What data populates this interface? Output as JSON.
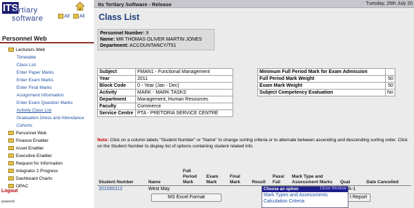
{
  "app": {
    "title": "Its Tertiary Software - Release",
    "date": "Tuesday, 26th July 20"
  },
  "logo": {
    "its": "ITS",
    "line1": "tertiary",
    "line2": "software"
  },
  "sidebar": {
    "expand_label": "All",
    "collapse_label": "All",
    "header": "Personnel Web",
    "tree": [
      {
        "label": "Lecturers Web",
        "type": "folder"
      },
      {
        "label": "Timetable",
        "type": "child"
      },
      {
        "label": "Class List",
        "type": "child"
      },
      {
        "label": "Enter Paper Marks",
        "type": "child"
      },
      {
        "label": "Enter Exam Marks",
        "type": "child"
      },
      {
        "label": "Enter Final Marks",
        "type": "child"
      },
      {
        "label": "Assignment Information",
        "type": "child"
      },
      {
        "label": "Enter Exam Question Marks",
        "type": "child"
      },
      {
        "label": "Activity Class List",
        "type": "child",
        "active": true
      },
      {
        "label": "Graduation Dress and Attendance",
        "type": "child"
      },
      {
        "label": "Cohorts",
        "type": "child"
      },
      {
        "label": "Personnel Web",
        "type": "folder"
      },
      {
        "label": "Finance Enabler",
        "type": "folder"
      },
      {
        "label": "Asset Enabler",
        "type": "folder"
      },
      {
        "label": "Executive Enabler",
        "type": "folder"
      },
      {
        "label": "Request for Information",
        "type": "folder"
      },
      {
        "label": "Integrator 2 Progress",
        "type": "folder"
      },
      {
        "label": "Dashboard Charts",
        "type": "folder"
      },
      {
        "label": "OPAC",
        "type": "folder"
      }
    ],
    "logout": "Logout",
    "powered": "powered"
  },
  "main": {
    "title": "Class List",
    "person": {
      "number_label": "Personnel Number:",
      "number": "9",
      "name_label": "Name:",
      "name": "MR THOMAS OLIVER MARTIN JONES",
      "dept_label": "Department:",
      "dept": "ACCOUNTANCY/T51"
    },
    "subject_info": [
      {
        "k": "Subject",
        "v": "FMAN1 - Functional Management"
      },
      {
        "k": "Year",
        "v": "2011"
      },
      {
        "k": "Block Code",
        "v": "0 - Year (Jan - Dec)"
      },
      {
        "k": "Activity",
        "v": "MARK - MARK TASKS"
      },
      {
        "k": "Department",
        "v": "Management, Human Resources"
      },
      {
        "k": "Faculty",
        "v": "Commerce"
      },
      {
        "k": "Service Centre",
        "v": "PTA - PRETORIA SERVICE CENTRE"
      }
    ],
    "mark_info": [
      {
        "k": "Minimum Full Period Mark for Exam Admission",
        "v": ""
      },
      {
        "k": "Full Period Mark Weight",
        "v": "50"
      },
      {
        "k": "Exam Mark Weight",
        "v": "50"
      },
      {
        "k": "Subject Competency Evaluation",
        "v": "No"
      }
    ],
    "note_label": "Note:",
    "note_text": " Click on a column labels \"Student Number\" or \"Name\" to change sorting criteria or to alternate between ascending and descending sorting order. Click on the Student Number to display list of options containing student related info.",
    "columns": [
      "Student Number",
      "Name",
      "Full Period Mark",
      "Exam Mark",
      "Final Mark",
      "Result",
      "Pass/ Fail",
      "Mark Type and Assessment Marks",
      "Qual",
      "Date Cancelled"
    ],
    "rows": [
      {
        "student_number": "201000112",
        "name": "West May",
        "full_period": "",
        "exam": "",
        "final": "",
        "result": "",
        "pass_fail": "",
        "mark_type": "View",
        "qual": "100A-1",
        "date_cancelled": ""
      }
    ],
    "excel_button": "MS Excel Format",
    "report_button": "t Report",
    "popup": {
      "title": "Choose an option",
      "close": "Close Window",
      "items": [
        "Mark Types and Assessments",
        "Calculation Criteria"
      ]
    }
  }
}
